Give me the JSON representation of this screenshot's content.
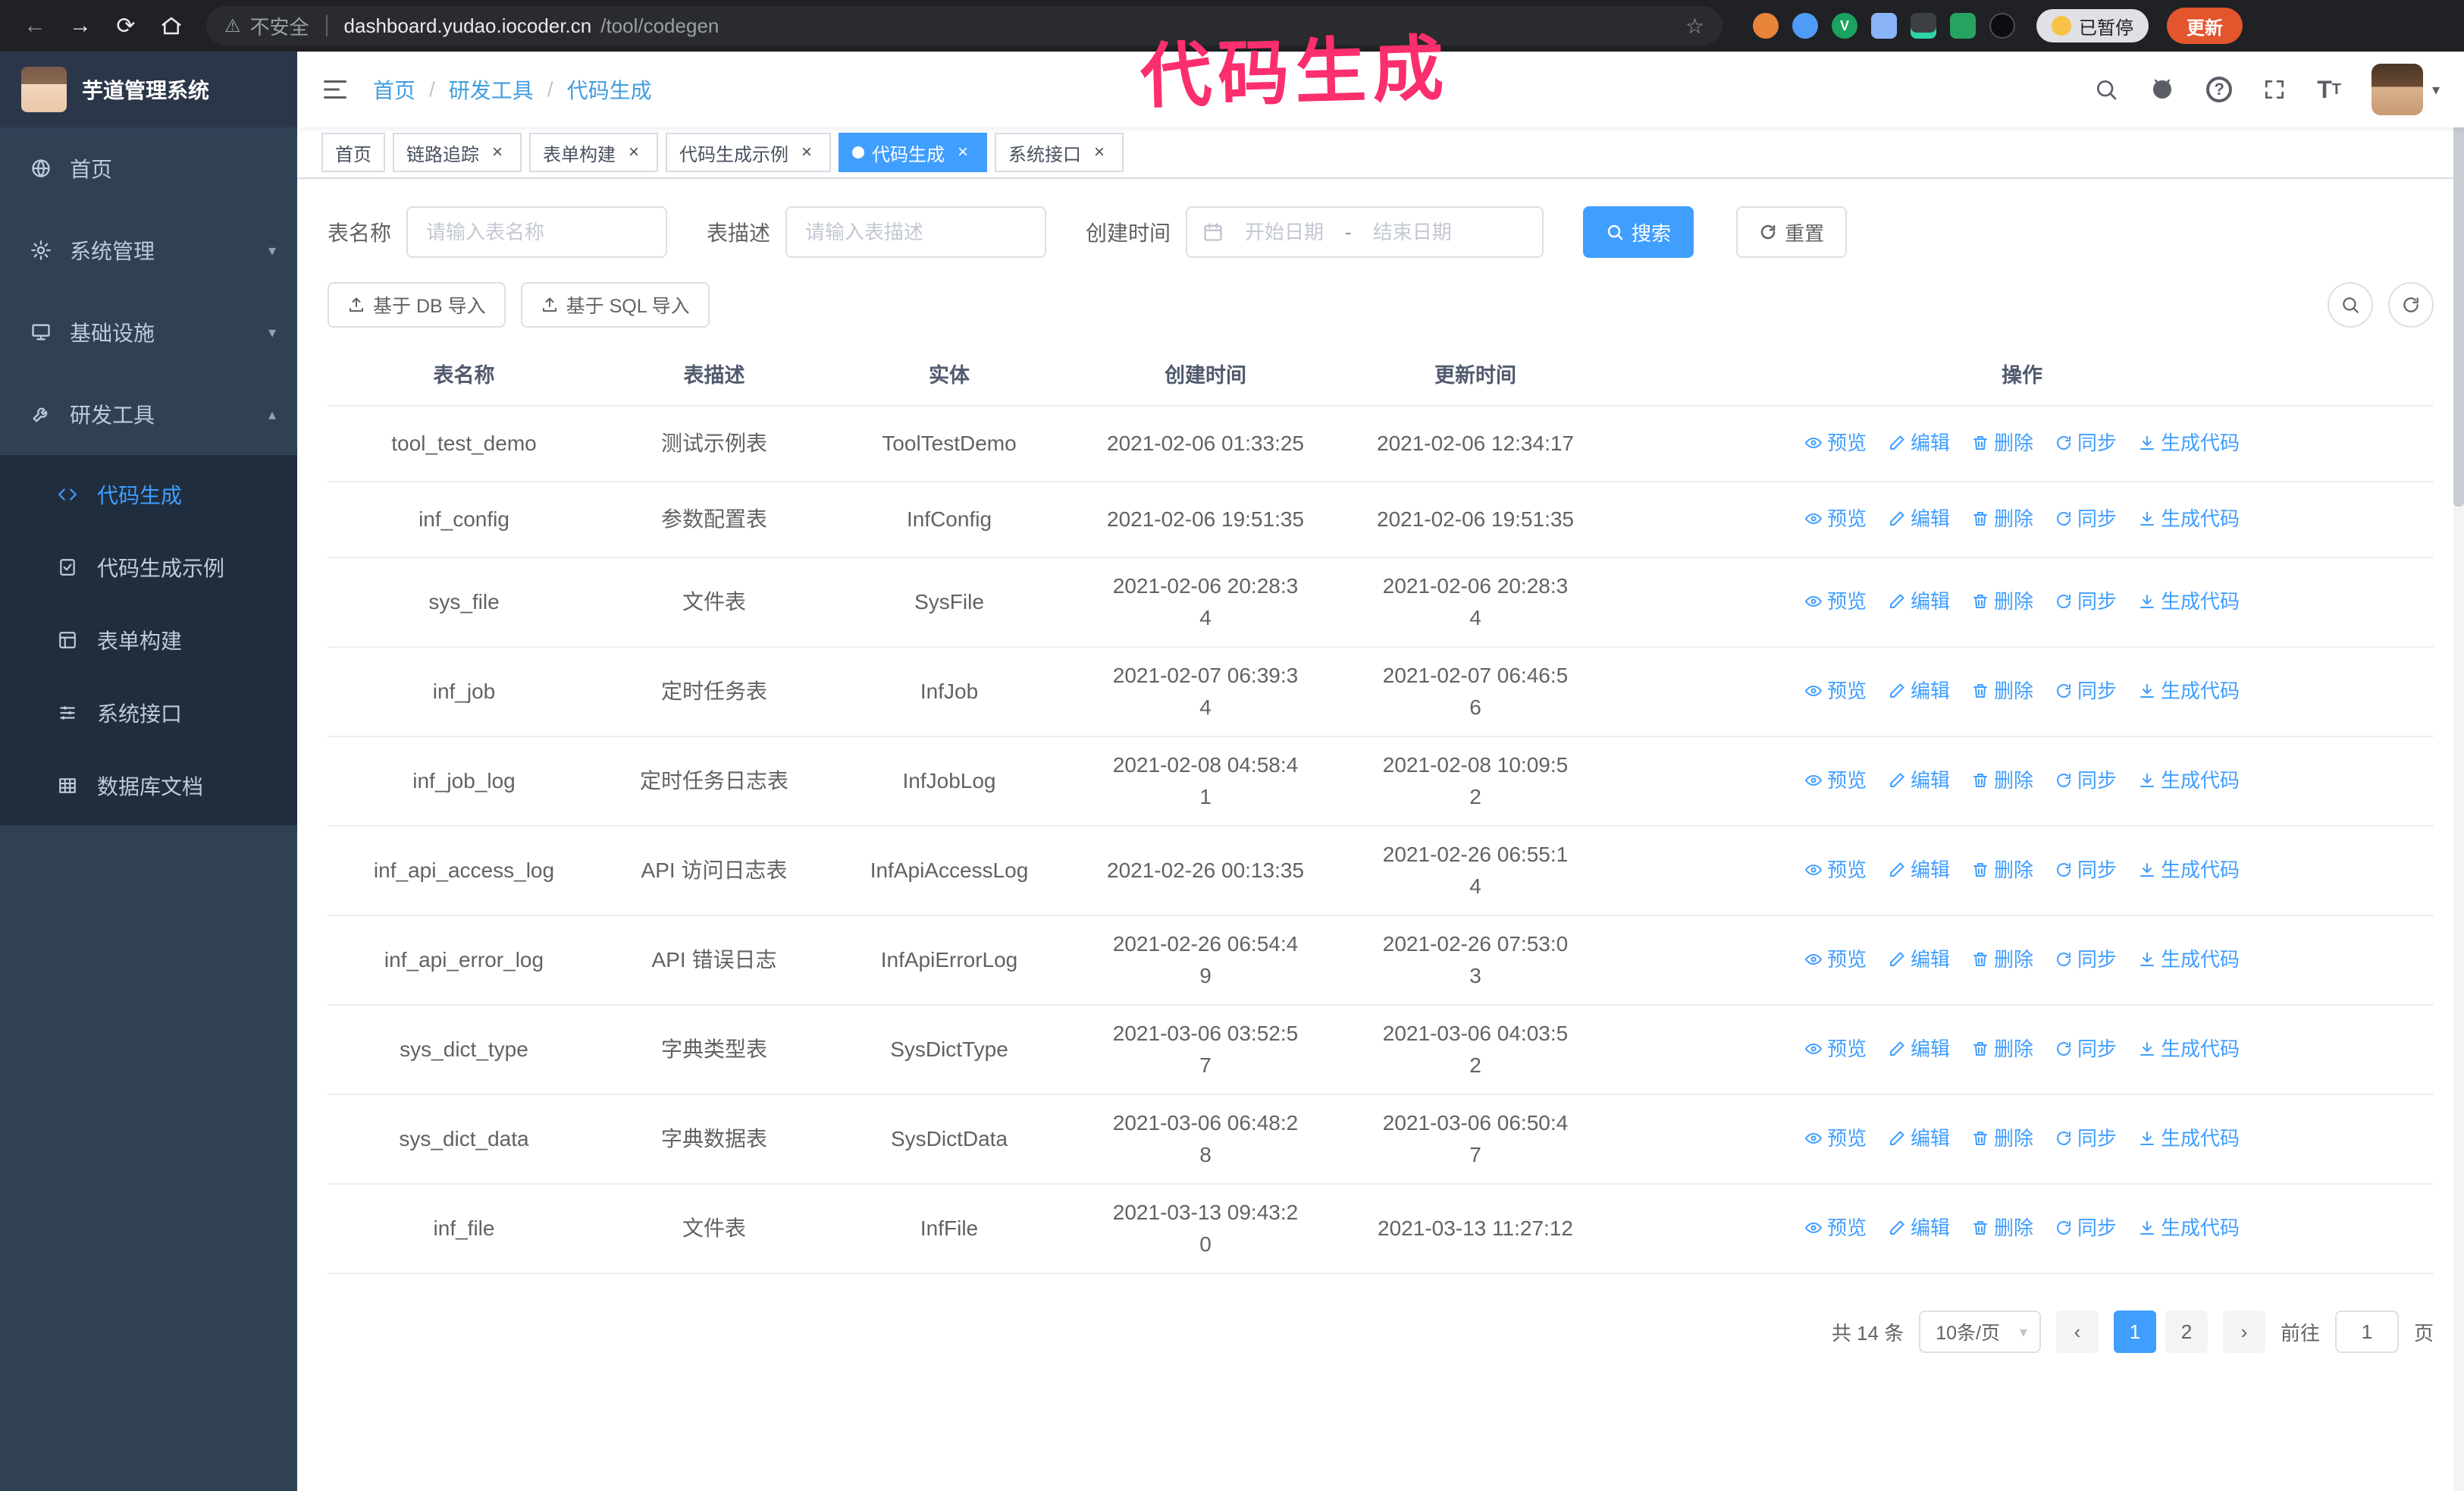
{
  "annotation": {
    "text": "代码生成",
    "color": "#fb2f6d"
  },
  "browser": {
    "security_label": "不安全",
    "url_host": "dashboard.yudao.iocoder.cn",
    "url_path": "/tool/codegen",
    "paused_badge": "已暂停",
    "update_button": "更新"
  },
  "sidebar": {
    "app_title": "芋道管理系统",
    "items": [
      {
        "label": "首页",
        "icon": "home",
        "expandable": false,
        "expanded": false
      },
      {
        "label": "系统管理",
        "icon": "gear",
        "expandable": true,
        "expanded": false
      },
      {
        "label": "基础设施",
        "icon": "infra",
        "expandable": true,
        "expanded": false
      },
      {
        "label": "研发工具",
        "icon": "tools",
        "expandable": true,
        "expanded": true
      }
    ],
    "submenu": [
      {
        "label": "代码生成",
        "icon": "code",
        "active": true
      },
      {
        "label": "代码生成示例",
        "icon": "example",
        "active": false
      },
      {
        "label": "表单构建",
        "icon": "form",
        "active": false
      },
      {
        "label": "系统接口",
        "icon": "api",
        "active": false
      },
      {
        "label": "数据库文档",
        "icon": "dbdoc",
        "active": false
      }
    ]
  },
  "header": {
    "breadcrumb": [
      "首页",
      "研发工具",
      "代码生成"
    ]
  },
  "tabs": [
    {
      "label": "首页",
      "closable": false,
      "active": false
    },
    {
      "label": "链路追踪",
      "closable": true,
      "active": false
    },
    {
      "label": "表单构建",
      "closable": true,
      "active": false
    },
    {
      "label": "代码生成示例",
      "closable": true,
      "active": false
    },
    {
      "label": "代码生成",
      "closable": true,
      "active": true
    },
    {
      "label": "系统接口",
      "closable": true,
      "active": false
    }
  ],
  "filters": {
    "table_name_label": "表名称",
    "table_name_placeholder": "请输入表名称",
    "table_desc_label": "表描述",
    "table_desc_placeholder": "请输入表描述",
    "create_time_label": "创建时间",
    "date_start_placeholder": "开始日期",
    "date_separator": "-",
    "date_end_placeholder": "结束日期",
    "search_button": "搜索",
    "reset_button": "重置"
  },
  "toolbar": {
    "import_db": "基于 DB 导入",
    "import_sql": "基于 SQL 导入"
  },
  "table": {
    "columns": [
      "表名称",
      "表描述",
      "实体",
      "创建时间",
      "更新时间",
      "操作"
    ],
    "ops": [
      {
        "key": "preview",
        "label": "预览",
        "icon": "eye"
      },
      {
        "key": "edit",
        "label": "编辑",
        "icon": "edit"
      },
      {
        "key": "delete",
        "label": "删除",
        "icon": "del"
      },
      {
        "key": "sync",
        "label": "同步",
        "icon": "sync"
      },
      {
        "key": "generate",
        "label": "生成代码",
        "icon": "download"
      }
    ],
    "rows": [
      {
        "name": "tool_test_demo",
        "desc": "测试示例表",
        "entity": "ToolTestDemo",
        "created": "2021-02-06 01:33:25",
        "updated": "2021-02-06 12:34:17"
      },
      {
        "name": "inf_config",
        "desc": "参数配置表",
        "entity": "InfConfig",
        "created": "2021-02-06 19:51:35",
        "updated": "2021-02-06 19:51:35"
      },
      {
        "name": "sys_file",
        "desc": "文件表",
        "entity": "SysFile",
        "created": "2021-02-06 20:28:3\n4",
        "updated": "2021-02-06 20:28:3\n4"
      },
      {
        "name": "inf_job",
        "desc": "定时任务表",
        "entity": "InfJob",
        "created": "2021-02-07 06:39:3\n4",
        "updated": "2021-02-07 06:46:5\n6"
      },
      {
        "name": "inf_job_log",
        "desc": "定时任务日志表",
        "entity": "InfJobLog",
        "created": "2021-02-08 04:58:4\n1",
        "updated": "2021-02-08 10:09:5\n2"
      },
      {
        "name": "inf_api_access_log",
        "desc": "API 访问日志表",
        "entity": "InfApiAccessLog",
        "created": "2021-02-26 00:13:35",
        "updated": "2021-02-26 06:55:1\n4"
      },
      {
        "name": "inf_api_error_log",
        "desc": "API 错误日志",
        "entity": "InfApiErrorLog",
        "created": "2021-02-26 06:54:4\n9",
        "updated": "2021-02-26 07:53:0\n3"
      },
      {
        "name": "sys_dict_type",
        "desc": "字典类型表",
        "entity": "SysDictType",
        "created": "2021-03-06 03:52:5\n7",
        "updated": "2021-03-06 04:03:5\n2"
      },
      {
        "name": "sys_dict_data",
        "desc": "字典数据表",
        "entity": "SysDictData",
        "created": "2021-03-06 06:48:2\n8",
        "updated": "2021-03-06 06:50:4\n7"
      },
      {
        "name": "inf_file",
        "desc": "文件表",
        "entity": "InfFile",
        "created": "2021-03-13 09:43:2\n0",
        "updated": "2021-03-13 11:27:12"
      }
    ]
  },
  "pagination": {
    "total_text": "共 14 条",
    "page_size": "10条/页",
    "pages": [
      "1",
      "2"
    ],
    "active_page": "1",
    "goto_label": "前往",
    "goto_value": "1",
    "goto_suffix": "页"
  }
}
